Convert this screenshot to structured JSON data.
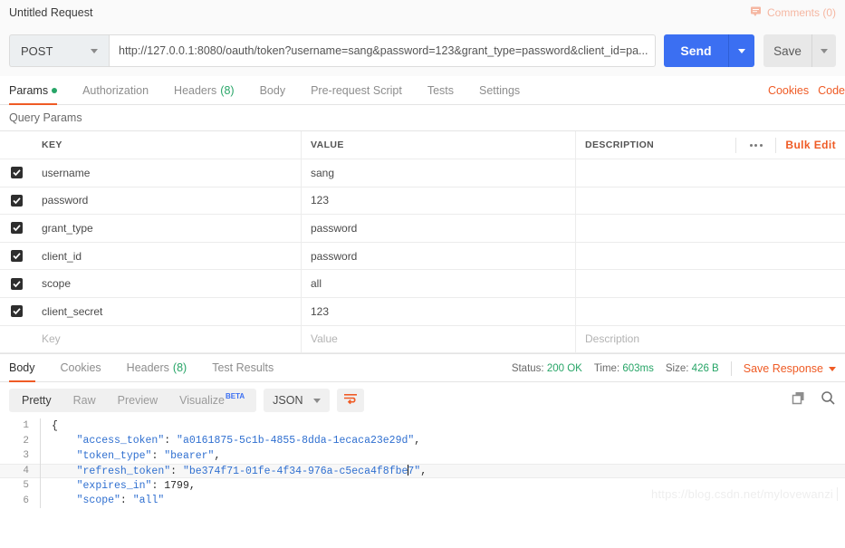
{
  "titlebar": {
    "request_title": "Untitled Request",
    "comments_label": "Comments (0)"
  },
  "urlbar": {
    "method": "POST",
    "url": "http://127.0.0.1:8080/oauth/token?username=sang&password=123&grant_type=password&client_id=pa...",
    "send_label": "Send",
    "save_label": "Save"
  },
  "request_tabs": {
    "items": [
      {
        "label": "Params",
        "badge": "dot",
        "active": true
      },
      {
        "label": "Authorization",
        "badge": "",
        "active": false
      },
      {
        "label": "Headers",
        "badge": "(8)",
        "active": false
      },
      {
        "label": "Body",
        "badge": "",
        "active": false
      },
      {
        "label": "Pre-request Script",
        "badge": "",
        "active": false
      },
      {
        "label": "Tests",
        "badge": "",
        "active": false
      },
      {
        "label": "Settings",
        "badge": "",
        "active": false
      }
    ],
    "cookies_link": "Cookies",
    "code_link": "Code"
  },
  "query_params": {
    "section_title": "Query Params",
    "columns": [
      "KEY",
      "VALUE",
      "DESCRIPTION"
    ],
    "bulk_edit_label": "Bulk Edit",
    "rows": [
      {
        "checked": true,
        "key": "username",
        "value": "sang",
        "description": ""
      },
      {
        "checked": true,
        "key": "password",
        "value": "123",
        "description": ""
      },
      {
        "checked": true,
        "key": "grant_type",
        "value": "password",
        "description": ""
      },
      {
        "checked": true,
        "key": "client_id",
        "value": "password",
        "description": ""
      },
      {
        "checked": true,
        "key": "scope",
        "value": "all",
        "description": ""
      },
      {
        "checked": true,
        "key": "client_secret",
        "value": "123",
        "description": ""
      }
    ],
    "placeholder_row": {
      "key": "Key",
      "value": "Value",
      "description": "Description"
    }
  },
  "response": {
    "tabs": [
      {
        "label": "Body",
        "badge": "",
        "active": true
      },
      {
        "label": "Cookies",
        "badge": "",
        "active": false
      },
      {
        "label": "Headers",
        "badge": "(8)",
        "active": false
      },
      {
        "label": "Test Results",
        "badge": "",
        "active": false
      }
    ],
    "status_label": "Status:",
    "status_value": "200 OK",
    "time_label": "Time:",
    "time_value": "603ms",
    "size_label": "Size:",
    "size_value": "426 B",
    "save_response_label": "Save Response",
    "format_tabs": [
      {
        "label": "Pretty",
        "active": true
      },
      {
        "label": "Raw",
        "active": false
      },
      {
        "label": "Preview",
        "active": false
      },
      {
        "label": "Visualize",
        "active": false,
        "superscript": "BETA"
      }
    ],
    "language": "JSON",
    "code_lines": [
      {
        "num": "1",
        "text": "{",
        "highlight": false
      },
      {
        "num": "2",
        "text": "    \"access_token\": \"a0161875-5c1b-4855-8dda-1ecaca23e29d\",",
        "highlight": false
      },
      {
        "num": "3",
        "text": "    \"token_type\": \"bearer\",",
        "highlight": false
      },
      {
        "num": "4",
        "text": "    \"refresh_token\": \"be374f71-01fe-4f34-976a-c5eca4f8fbe7\",",
        "highlight": true
      },
      {
        "num": "5",
        "text": "    \"expires_in\": 1799,",
        "highlight": false
      },
      {
        "num": "6",
        "text": "    \"scope\": \"all\"",
        "highlight": false
      }
    ],
    "json_body": {
      "access_token": "a0161875-5c1b-4855-8dda-1ecaca23e29d",
      "token_type": "bearer",
      "refresh_token": "be374f71-01fe-4f34-976a-c5eca4f8fbe7",
      "expires_in": 1799,
      "scope": "all"
    }
  },
  "watermark": "https://blog.csdn.net/mylovewanzi",
  "colors": {
    "accent_orange": "#ef5b25",
    "send_blue": "#3b6ff2",
    "status_green": "#27a567",
    "comments_salmon": "#f5b7a2"
  }
}
